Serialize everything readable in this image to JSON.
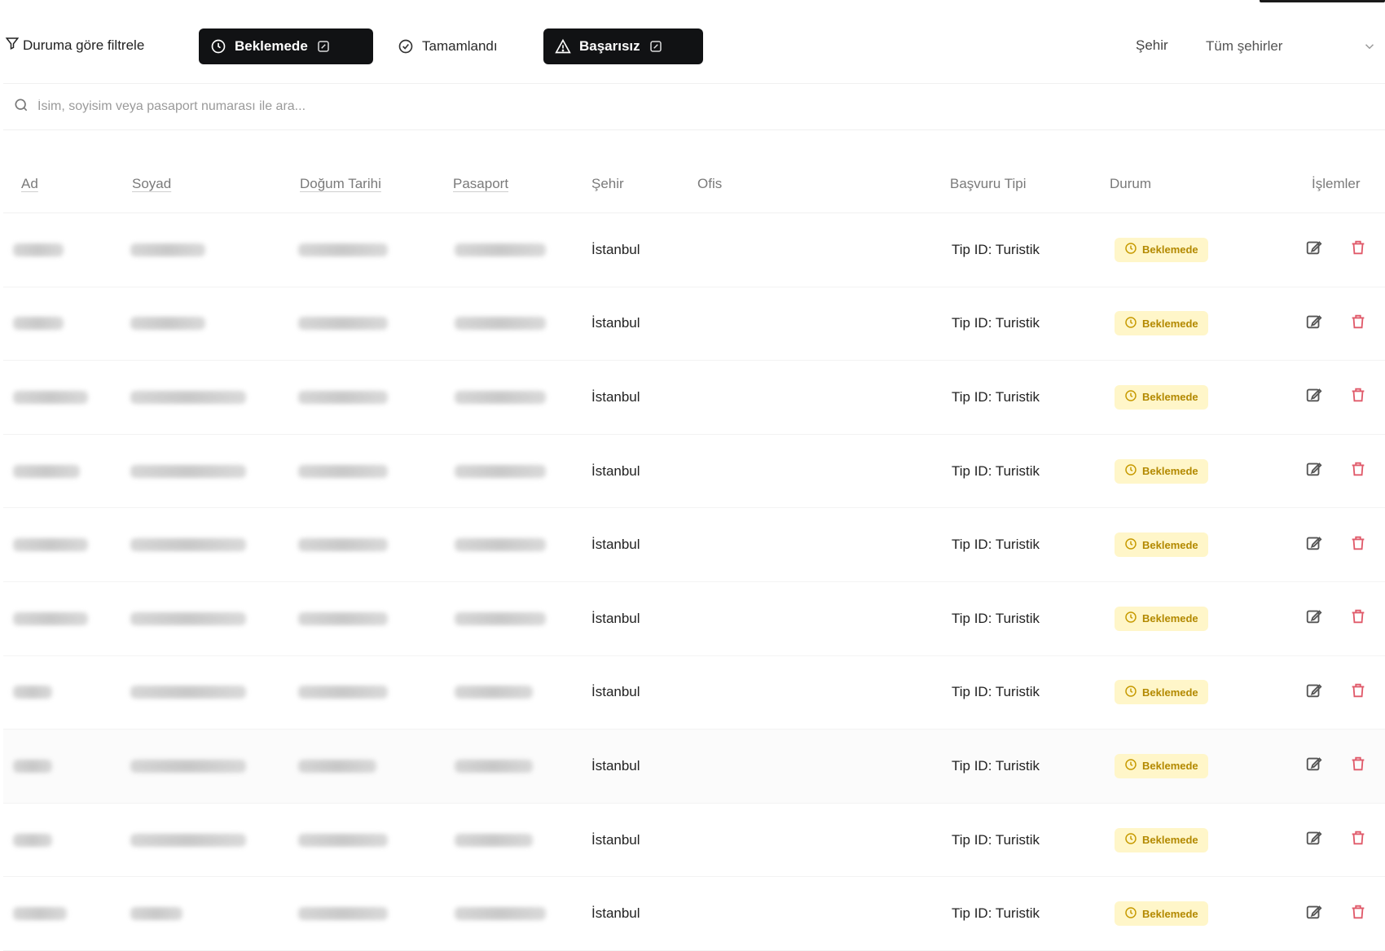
{
  "filter": {
    "label": "Duruma göre filtrele",
    "chips": [
      {
        "label": "Beklemede",
        "active": true
      },
      {
        "label": "Tamamlandı",
        "active": false
      },
      {
        "label": "Başarısız",
        "active": true
      }
    ],
    "city_label": "Şehir",
    "city_value": "Tüm şehirler"
  },
  "search": {
    "placeholder": "İsim, soyisim veya pasaport numarası ile ara..."
  },
  "table": {
    "headers": {
      "ad": "Ad",
      "soyad": "Soyad",
      "dogum": "Doğum Tarihi",
      "pasaport": "Pasaport",
      "sehir": "Şehir",
      "ofis": "Ofis",
      "basvuru": "Başvuru Tipi",
      "durum": "Durum",
      "islemler": "İşlemler"
    },
    "rows": [
      {
        "sehir": "İstanbul",
        "basvuru": "Tip ID: Turistik",
        "durum": "Beklemede"
      },
      {
        "sehir": "İstanbul",
        "basvuru": "Tip ID: Turistik",
        "durum": "Beklemede"
      },
      {
        "sehir": "İstanbul",
        "basvuru": "Tip ID: Turistik",
        "durum": "Beklemede"
      },
      {
        "sehir": "İstanbul",
        "basvuru": "Tip ID: Turistik",
        "durum": "Beklemede"
      },
      {
        "sehir": "İstanbul",
        "basvuru": "Tip ID: Turistik",
        "durum": "Beklemede"
      },
      {
        "sehir": "İstanbul",
        "basvuru": "Tip ID: Turistik",
        "durum": "Beklemede"
      },
      {
        "sehir": "İstanbul",
        "basvuru": "Tip ID: Turistik",
        "durum": "Beklemede"
      },
      {
        "sehir": "İstanbul",
        "basvuru": "Tip ID: Turistik",
        "durum": "Beklemede"
      },
      {
        "sehir": "İstanbul",
        "basvuru": "Tip ID: Turistik",
        "durum": "Beklemede"
      },
      {
        "sehir": "İstanbul",
        "basvuru": "Tip ID: Turistik",
        "durum": "Beklemede"
      }
    ]
  },
  "colors": {
    "chip_dark": "#111214",
    "badge_bg": "#fff6c9",
    "badge_text": "#b38900",
    "delete_red": "#e05a6a",
    "edit_gray": "#555555"
  },
  "icons": [
    "filter-icon",
    "clock-icon",
    "edit-icon",
    "check-circle-icon",
    "warning-icon",
    "chevron-down-icon",
    "search-icon",
    "delete-icon"
  ]
}
